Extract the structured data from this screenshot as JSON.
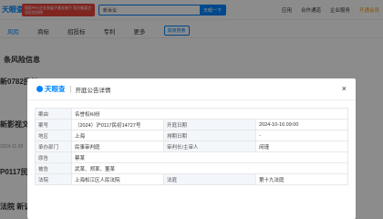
{
  "bg": {
    "logo": "天眼查",
    "ad_text": "国家中小企业发展子基金旗下 官方备案企业征信机构",
    "search_value": "新诉讼",
    "search_button": "天眼一下",
    "nav": [
      "应用",
      "合作通道",
      "企业服务",
      "开通会员"
    ],
    "tabs": [
      "风险",
      "商标",
      "招投标",
      "专利",
      "更多"
    ],
    "tab_filter": "高级搜索",
    "section_title": "条风险信息",
    "rows": [
      "新0782民初",
      "新影视文化",
      "P0117民初",
      "新诉讼",
      "法院 新诉讼消息"
    ],
    "sub": [
      "2024-11-28",
      "2024-11-28"
    ]
  },
  "modal": {
    "brand": "天眼查",
    "title": "开庭公告详情",
    "close": "×",
    "fields": {
      "case_reason_label": "案由",
      "case_reason": "名誉权纠纷",
      "case_no_label": "案号",
      "case_no": "（2024）沪0117民初14727号",
      "date_label": "开庭日期",
      "date": "2024-10-16 09:00",
      "region_label": "地区",
      "region": "上海",
      "schedule_label": "排期日期",
      "schedule": "-",
      "dept_label": "承办部门",
      "dept": "民事审判庭",
      "judge_label": "审判长/主审人",
      "judge": "闵瑾",
      "plaintiff_label": "原告",
      "plaintiff": "蔡某",
      "defendant_label": "被告",
      "defendant": "武某、郑某、董某",
      "court_label": "法院",
      "court": "上海松江区人民法院",
      "courtroom_label": "法庭",
      "courtroom": "第十九法庭"
    }
  }
}
